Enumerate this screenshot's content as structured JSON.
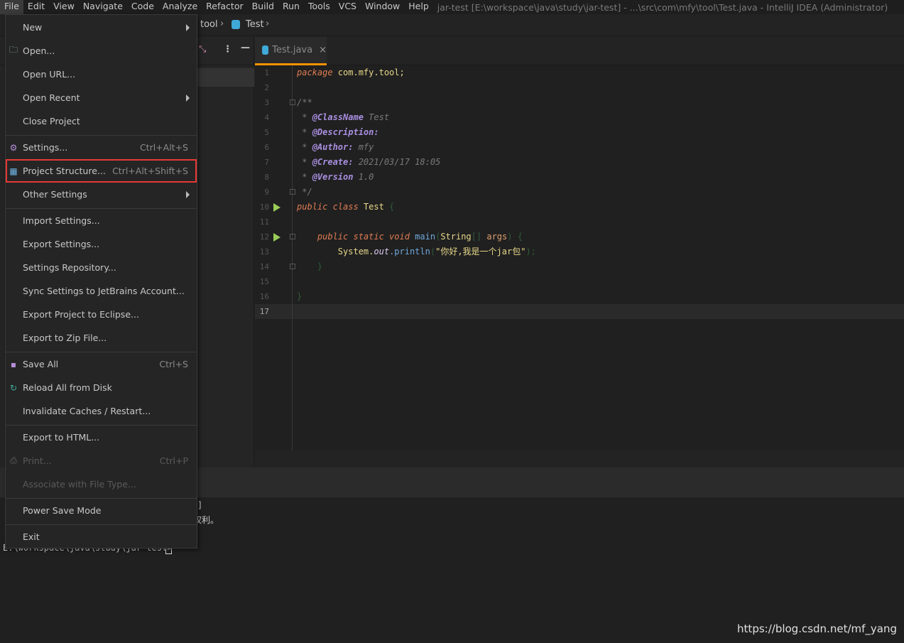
{
  "menubar": {
    "items": [
      "File",
      "Edit",
      "View",
      "Navigate",
      "Code",
      "Analyze",
      "Refactor",
      "Build",
      "Run",
      "Tools",
      "VCS",
      "Window",
      "Help"
    ],
    "title": "jar-test [E:\\workspace\\java\\study\\jar-test] - ...\\src\\com\\mfy\\tool\\Test.java - IntelliJ IDEA (Administrator)"
  },
  "breadcrumb": {
    "items": [
      "tool",
      "Test"
    ]
  },
  "tab": {
    "label": "Test.java",
    "close": "×"
  },
  "editor": {
    "lines": [
      "1",
      "2",
      "3",
      "4",
      "5",
      "6",
      "7",
      "8",
      "9",
      "10",
      "11",
      "12",
      "13",
      "14",
      "15",
      "16",
      "17"
    ],
    "code": {
      "l1a": "package",
      "l1b": " com.mfy.tool;",
      "l3": "/**",
      "l4a": " * ",
      "l4b": "@ClassName",
      "l4c": " Test",
      "l5a": " * ",
      "l5b": "@Description:",
      "l6a": " * ",
      "l6b": "@Author:",
      "l6c": " mfy",
      "l7a": " * ",
      "l7b": "@Create:",
      "l7c": " 2021/03/17 18:05",
      "l8a": " * ",
      "l8b": "@Version",
      "l8c": " 1.0",
      "l9": " */",
      "l10a": "public class ",
      "l10b": "Test ",
      "l10c": "{",
      "l12a": "    public static void ",
      "l12b": "main",
      "l12c": "(",
      "l12d": "String",
      "l12e": "[] ",
      "l12f": "args",
      "l12g": ") {",
      "l13a": "        System.",
      "l13b": "out",
      "l13c": ".println",
      "l13d": "(",
      "l13e": "\"你好,我是一个jar包\"",
      "l13f": ");",
      "l14": "    }",
      "l16": "}"
    }
  },
  "menu": {
    "items": [
      {
        "label": "New",
        "submenu": true
      },
      {
        "label": "Open...",
        "icon": "folder-icon"
      },
      {
        "label": "Open URL..."
      },
      {
        "label": "Open Recent",
        "submenu": true
      },
      {
        "label": "Close Project"
      },
      {
        "label": "Settings...",
        "shortcut": "Ctrl+Alt+S",
        "icon": "gear-icon"
      },
      {
        "label": "Project Structure...",
        "shortcut": "Ctrl+Alt+Shift+S",
        "icon": "grid-icon",
        "highlighted": true
      },
      {
        "label": "Other Settings",
        "submenu": true
      },
      {
        "label": "Import Settings..."
      },
      {
        "label": "Export Settings..."
      },
      {
        "label": "Settings Repository..."
      },
      {
        "label": "Sync Settings to JetBrains Account..."
      },
      {
        "label": "Export Project to Eclipse..."
      },
      {
        "label": "Export to Zip File..."
      },
      {
        "label": "Save All",
        "shortcut": "Ctrl+S",
        "icon": "save-icon"
      },
      {
        "label": "Reload All from Disk",
        "icon": "reload-icon"
      },
      {
        "label": "Invalidate Caches / Restart..."
      },
      {
        "label": "Export to HTML..."
      },
      {
        "label": "Print...",
        "shortcut": "Ctrl+P",
        "icon": "print-icon",
        "disabled": true
      },
      {
        "label": "Associate with File Type...",
        "disabled": true
      },
      {
        "label": "Power Save Mode"
      },
      {
        "label": "Exit"
      }
    ]
  },
  "terminal": {
    "frag1": "]",
    "frag2": "权利。",
    "prompt": "E:\\workspace\\java\\study\\jar-test>"
  },
  "watermark": "https://blog.csdn.net/mf_yang",
  "colors": {
    "accent": "#f59300",
    "highlight_box": "#e53935"
  }
}
